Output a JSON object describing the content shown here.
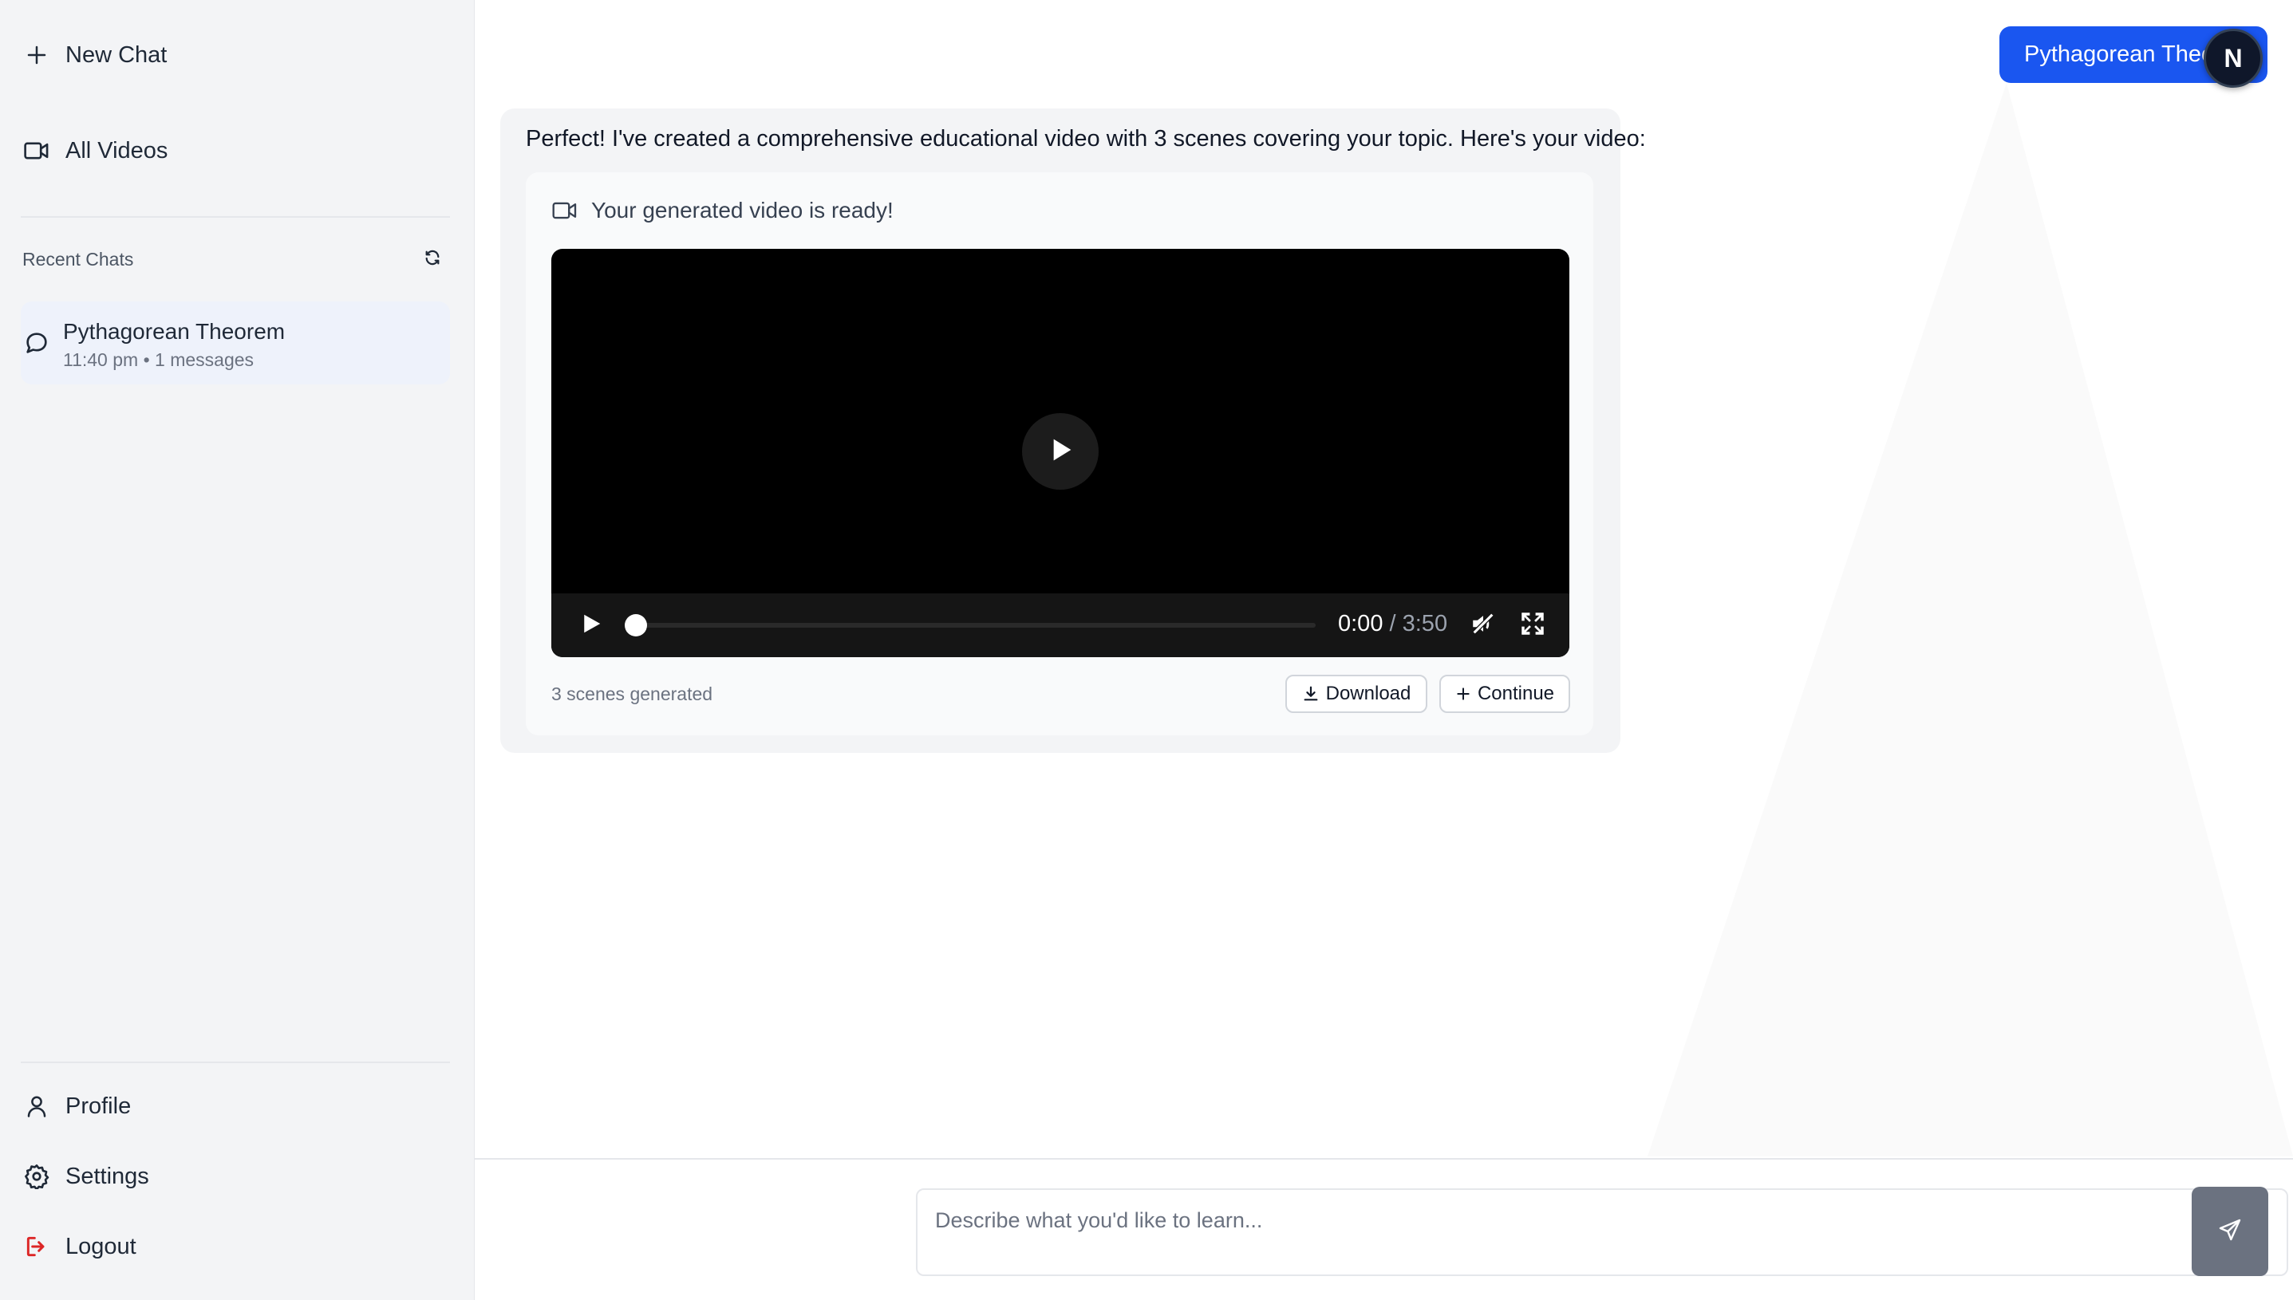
{
  "sidebar": {
    "new_chat_label": "New Chat",
    "all_videos_label": "All Videos",
    "recent_chats_title": "Recent Chats",
    "recent_chats": [
      {
        "title": "Pythagorean Theorem",
        "meta": "11:40 pm • 1 messages"
      }
    ],
    "profile_label": "Profile",
    "settings_label": "Settings",
    "logout_label": "Logout"
  },
  "conversation": {
    "user_message": "Pythagorean Theorem",
    "avatar_initial": "N",
    "assistant_message": "Perfect! I've created a comprehensive educational video with 3 scenes covering your topic. Here's your video:",
    "video_ready_label": "Your generated video is ready!",
    "video": {
      "current_time": "0:00",
      "separator": " / ",
      "duration": "3:50",
      "progress": 0
    },
    "scenes_label": "3 scenes generated",
    "download_label": "Download",
    "continue_label": "Continue"
  },
  "composer": {
    "placeholder": "Describe what you'd like to learn..."
  },
  "colors": {
    "accent": "#1a56f0",
    "logout": "#dc2626",
    "send_button": "#6b7280"
  },
  "icons": [
    "plus-icon",
    "video-camera-icon",
    "refresh-icon",
    "chat-bubble-icon",
    "user-icon",
    "gear-icon",
    "logout-icon",
    "play-icon",
    "mute-icon",
    "fullscreen-icon",
    "download-icon",
    "send-icon"
  ]
}
